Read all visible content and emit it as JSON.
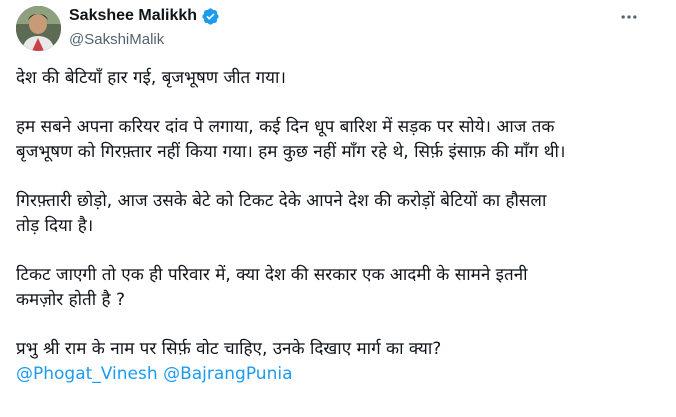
{
  "author": {
    "display_name": "Sakshee Malikkh",
    "handle": "@SakshiMalik",
    "verified_badge_icon": "verified-check-icon",
    "badge_color": "#1d9bf0"
  },
  "more_icon": "more-horizontal-icon",
  "tweet": {
    "paragraphs": [
      {
        "lines": [
          "देश की बेटियाँ हार गई, बृजभूषण जीत गया।"
        ]
      },
      {
        "lines": [
          "हम सबने अपना करियर दांव पे लगाया, कई दिन धूप बारिश में सड़क पर सोये। आज तक",
          "बृजभूषण को गिरफ़्तार नहीं किया गया। हम कुछ नहीं माँग रहे थे, सिर्फ़ इंसाफ़ की माँग थी।"
        ]
      },
      {
        "lines": [
          "गिरफ़्तारी छोड़ो, आज उसके बेटे को टिकट देके आपने देश की करोड़ों बेटियों का हौसला",
          "तोड़ दिया है।"
        ]
      },
      {
        "lines": [
          "टिकट जाएगी तो एक ही परिवार में, क्या देश की सरकार एक आदमी के सामने इतनी",
          "कमज़ोर होती है ?"
        ]
      },
      {
        "lines": [
          "प्रभु श्री राम के नाम पर सिर्फ़ वोट चाहिए, उनके दिखाए मार्ग का क्या?"
        ]
      }
    ],
    "mentions": [
      "@Phogat_Vinesh",
      "@BajrangPunia"
    ]
  },
  "colors": {
    "text": "#0f1419",
    "secondary": "#536471",
    "link": "#1d9bf0"
  }
}
